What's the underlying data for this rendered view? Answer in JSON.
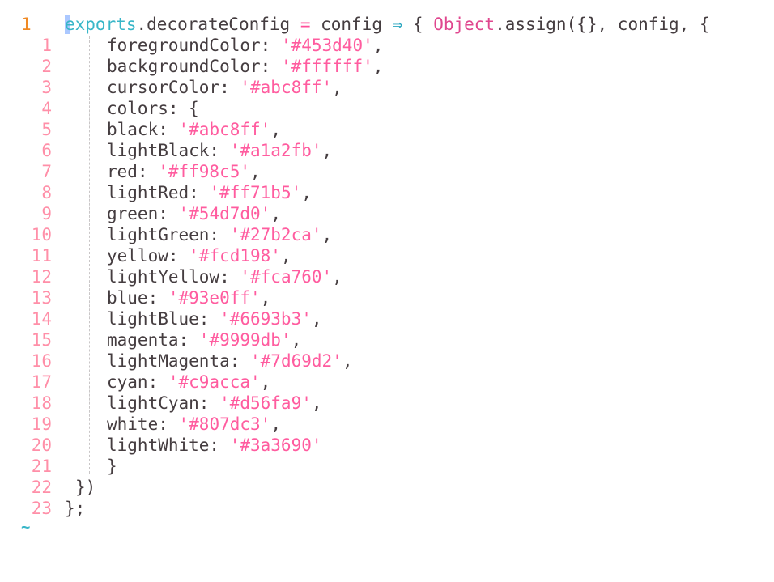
{
  "editor": {
    "current_line_number": "1",
    "header": {
      "export_kw": "exports",
      "member": ".decorateConfig ",
      "assign_op": "=",
      "param": " config ",
      "arrow": "⇒",
      "brace_open": " { ",
      "object_builtin": "Object",
      "assign_call": ".assign({}, config, {"
    },
    "lines": [
      {
        "num": "1",
        "key": "foregroundColor: ",
        "value": "'#453d40'",
        "tail": ","
      },
      {
        "num": "2",
        "key": "backgroundColor: ",
        "value": "'#ffffff'",
        "tail": ","
      },
      {
        "num": "3",
        "key": "cursorColor: ",
        "value": "'#abc8ff'",
        "tail": ","
      },
      {
        "num": "4",
        "key": "colors: {",
        "value": "",
        "tail": ""
      },
      {
        "num": "5",
        "key": "black: ",
        "value": "'#abc8ff'",
        "tail": ","
      },
      {
        "num": "6",
        "key": "lightBlack: ",
        "value": "'#a1a2fb'",
        "tail": ","
      },
      {
        "num": "7",
        "key": "red: ",
        "value": "'#ff98c5'",
        "tail": ","
      },
      {
        "num": "8",
        "key": "lightRed: ",
        "value": "'#ff71b5'",
        "tail": ","
      },
      {
        "num": "9",
        "key": "green: ",
        "value": "'#54d7d0'",
        "tail": ","
      },
      {
        "num": "10",
        "key": "lightGreen: ",
        "value": "'#27b2ca'",
        "tail": ","
      },
      {
        "num": "11",
        "key": "yellow: ",
        "value": "'#fcd198'",
        "tail": ","
      },
      {
        "num": "12",
        "key": "lightYellow: ",
        "value": "'#fca760'",
        "tail": ","
      },
      {
        "num": "13",
        "key": "blue: ",
        "value": "'#93e0ff'",
        "tail": ","
      },
      {
        "num": "14",
        "key": "lightBlue: ",
        "value": "'#6693b3'",
        "tail": ","
      },
      {
        "num": "15",
        "key": "magenta: ",
        "value": "'#9999db'",
        "tail": ","
      },
      {
        "num": "16",
        "key": "lightMagenta: ",
        "value": "'#7d69d2'",
        "tail": ","
      },
      {
        "num": "17",
        "key": "cyan: ",
        "value": "'#c9acca'",
        "tail": ","
      },
      {
        "num": "18",
        "key": "lightCyan: ",
        "value": "'#d56fa9'",
        "tail": ","
      },
      {
        "num": "19",
        "key": "white: ",
        "value": "'#807dc3'",
        "tail": ","
      },
      {
        "num": "20",
        "key": "lightWhite: ",
        "value": "'#3a3690'",
        "tail": ""
      },
      {
        "num": "21",
        "key": "}",
        "value": "",
        "tail": ""
      }
    ],
    "closing_lines": [
      {
        "num": "22",
        "text": "})"
      },
      {
        "num": "23",
        "text": "};"
      }
    ],
    "empty_line_marker": "~"
  },
  "colors": {
    "foreground": "#453d40",
    "background": "#ffffff",
    "cursor": "#abc8ff",
    "keyword": "#38b6c8",
    "string": "#ff5c9f",
    "line_number": "#ff8fa8",
    "current_line_number": "#f08a24"
  }
}
